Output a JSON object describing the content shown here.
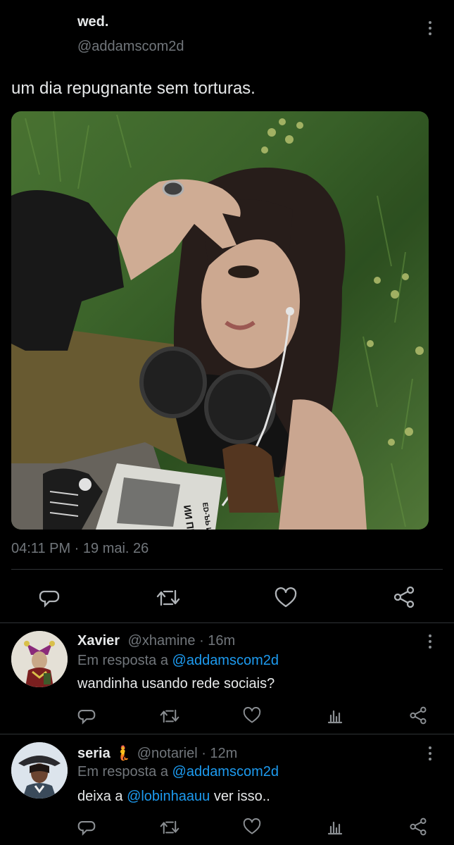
{
  "tweet": {
    "author_name": "wed.",
    "author_handle": "@addamscom2d",
    "text": "um dia repugnante sem torturas.",
    "timestamp": "04:11 PM · 19 mai. 26",
    "photo_text_1": "ИИ ПБDIKE",
    "photo_text_2": "ED-ЪЬ ИIECE?"
  },
  "actions": [
    "reply-icon",
    "retweet-icon",
    "like-icon",
    "share-icon"
  ],
  "replies": [
    {
      "name": "Xavier",
      "handle": "@xhamine",
      "time": "· 16m",
      "reply_prefix": "Em resposta a",
      "reply_to": "@addamscom2d",
      "text": "wandinha usando rede sociais?"
    },
    {
      "name": "seria",
      "emoji": "🧜",
      "handle": "@notariel",
      "time": "· 12m",
      "reply_prefix": "Em resposta a",
      "reply_to": "@addamscom2d",
      "text_before": "deixa a",
      "mention": "@lobinhaauu",
      "text_after": "ver isso.."
    }
  ],
  "colors": {
    "background": "#000000",
    "text": "#e7e9ea",
    "muted": "#71767b",
    "link": "#1d9bf0"
  }
}
